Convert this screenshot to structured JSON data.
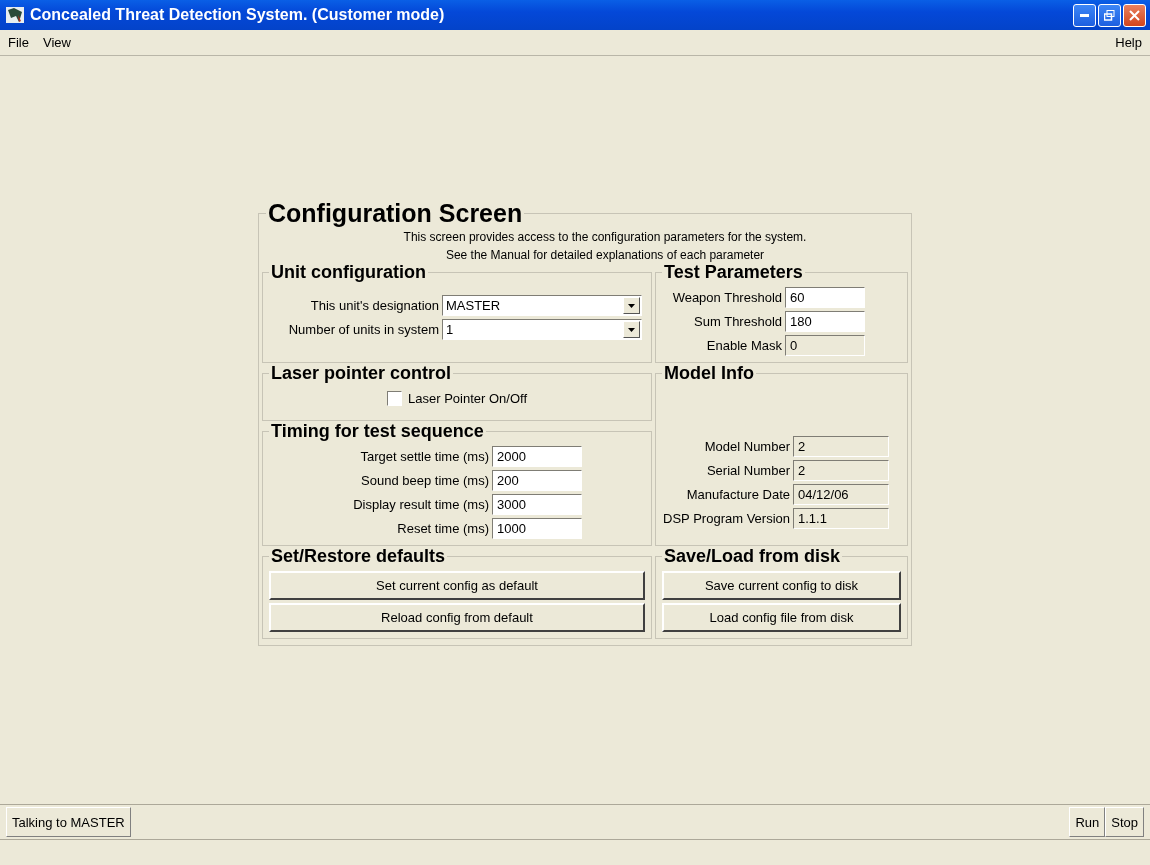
{
  "window": {
    "title": "Concealed Threat Detection System.  (Customer mode)"
  },
  "menu": {
    "left": [
      "File",
      "View"
    ],
    "right": [
      "Help"
    ]
  },
  "config": {
    "title": "Configuration Screen",
    "intro": [
      "This screen provides access to the configuration parameters for the system.",
      "See the Manual for detailed explanations of each parameter"
    ],
    "unit": {
      "title": "Unit configuration",
      "combos": [
        {
          "label": "This unit's designation",
          "value": "MASTER"
        },
        {
          "label": "Number of units in system",
          "value": "1"
        }
      ]
    },
    "test": {
      "title": "Test Parameters",
      "fields": [
        {
          "label": "Weapon Threshold",
          "value": "60",
          "readonly": false
        },
        {
          "label": "Sum Threshold",
          "value": "180",
          "readonly": false
        },
        {
          "label": "Enable Mask",
          "value": "0",
          "readonly": true
        }
      ]
    },
    "laser": {
      "title": "Laser pointer control",
      "checkbox": {
        "label": "Laser Pointer On/Off",
        "checked": false
      }
    },
    "model": {
      "title": "Model Info",
      "fields": [
        {
          "label": "Model Number",
          "value": "2",
          "readonly": true
        },
        {
          "label": "Serial Number",
          "value": "2",
          "readonly": true
        },
        {
          "label": "Manufacture Date",
          "value": "04/12/06",
          "readonly": true
        },
        {
          "label": "DSP Program Version",
          "value": "1.1.1",
          "readonly": true
        }
      ]
    },
    "timing": {
      "title": "Timing for test sequence",
      "fields": [
        {
          "label": "Target settle time (ms)",
          "value": "2000",
          "readonly": false
        },
        {
          "label": "Sound beep time (ms)",
          "value": "200",
          "readonly": false
        },
        {
          "label": "Display result time (ms)",
          "value": "3000",
          "readonly": false
        },
        {
          "label": "Reset time (ms)",
          "value": "1000",
          "readonly": false
        }
      ]
    },
    "defaults": {
      "title": "Set/Restore defaults",
      "buttons": [
        "Set current config as default",
        "Reload config from default"
      ]
    },
    "disk": {
      "title": "Save/Load from disk",
      "buttons": [
        "Save current config to disk",
        "Load config file from disk"
      ]
    }
  },
  "status": {
    "connection": "Talking to MASTER",
    "buttons": [
      "Run",
      "Stop"
    ]
  }
}
